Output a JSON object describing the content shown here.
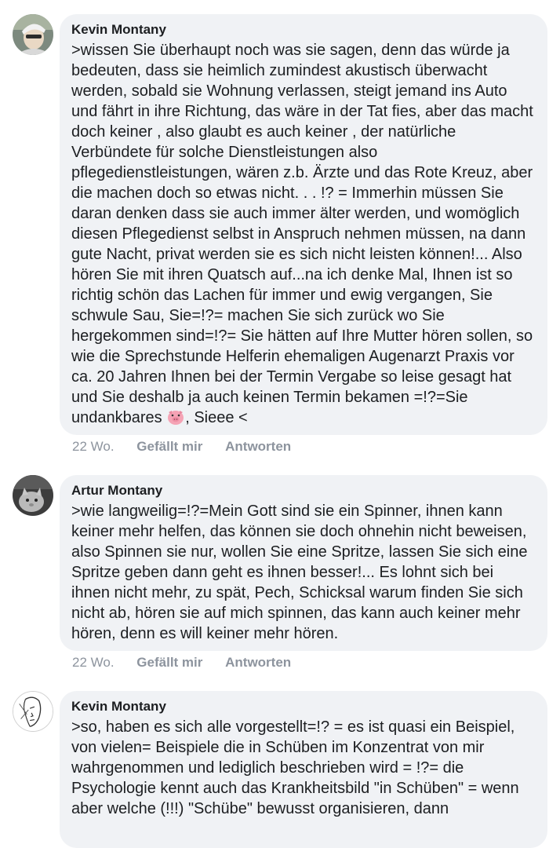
{
  "comments": [
    {
      "author": "Kevin Montany",
      "text_before_emoji": ">wissen Sie überhaupt noch was sie sagen, denn das würde ja bedeuten, dass sie heimlich zumindest akustisch überwacht werden, sobald sie Wohnung verlassen, steigt jemand ins Auto und fährt in ihre Richtung, das wäre in der Tat fies, aber das macht doch keiner , also glaubt es auch keiner , der natürliche Verbündete für solche Dienstleistungen also pflegedienstleistungen, wären z.b. Ärzte und das Rote Kreuz, aber die machen doch so etwas nicht. . . !? = Immerhin müssen Sie daran denken dass sie auch immer älter werden, und womöglich diesen Pflegedienst selbst in Anspruch nehmen müssen, na dann gute Nacht, privat werden sie es sich nicht leisten können!... Also hören Sie mit ihren Quatsch auf...na ich denke Mal, Ihnen ist so richtig schön das Lachen für immer und ewig vergangen, Sie schwule Sau, Sie=!?= machen Sie sich zurück wo Sie hergekommen sind=!?= Sie hätten auf Ihre Mutter hören sollen, so wie die Sprechstunde Helferin ehemaligen Augenarzt Praxis vor ca. 20 Jahren Ihnen bei der Termin Vergabe so leise gesagt hat und Sie deshalb ja auch keinen Termin bekamen =!?=Sie undankbares ",
      "emoji": "pig-face-icon",
      "text_after_emoji": ", Sieee <",
      "time": "22 Wo.",
      "like_label": "Gefällt mir",
      "reply_label": "Antworten"
    },
    {
      "author": "Artur Montany",
      "text": ">wie langweilig=!?=Mein Gott sind sie ein Spinner, ihnen kann keiner mehr helfen, das können sie doch ohnehin nicht beweisen, also Spinnen sie nur, wollen Sie eine Spritze, lassen Sie sich eine Spritze geben dann geht es ihnen besser!... Es lohnt sich bei ihnen nicht mehr, zu spät, Pech, Schicksal warum finden Sie sich nicht ab, hören sie auf mich spinnen, das kann auch keiner mehr hören, denn es will keiner mehr hören.",
      "time": "22 Wo.",
      "like_label": "Gefällt mir",
      "reply_label": "Antworten"
    },
    {
      "author": "Kevin Montany",
      "text": ">so, haben es sich alle vorgestellt=!? = es ist quasi ein Beispiel, von vielen= Beispiele die in Schüben im Konzentrat von mir wahrgenommen und lediglich beschrieben wird = !?= die Psychologie kennt auch das Krankheitsbild \"in Schüben\" = wenn aber welche (!!!) \"Schübe\" bewusst organisieren, dann"
    }
  ]
}
